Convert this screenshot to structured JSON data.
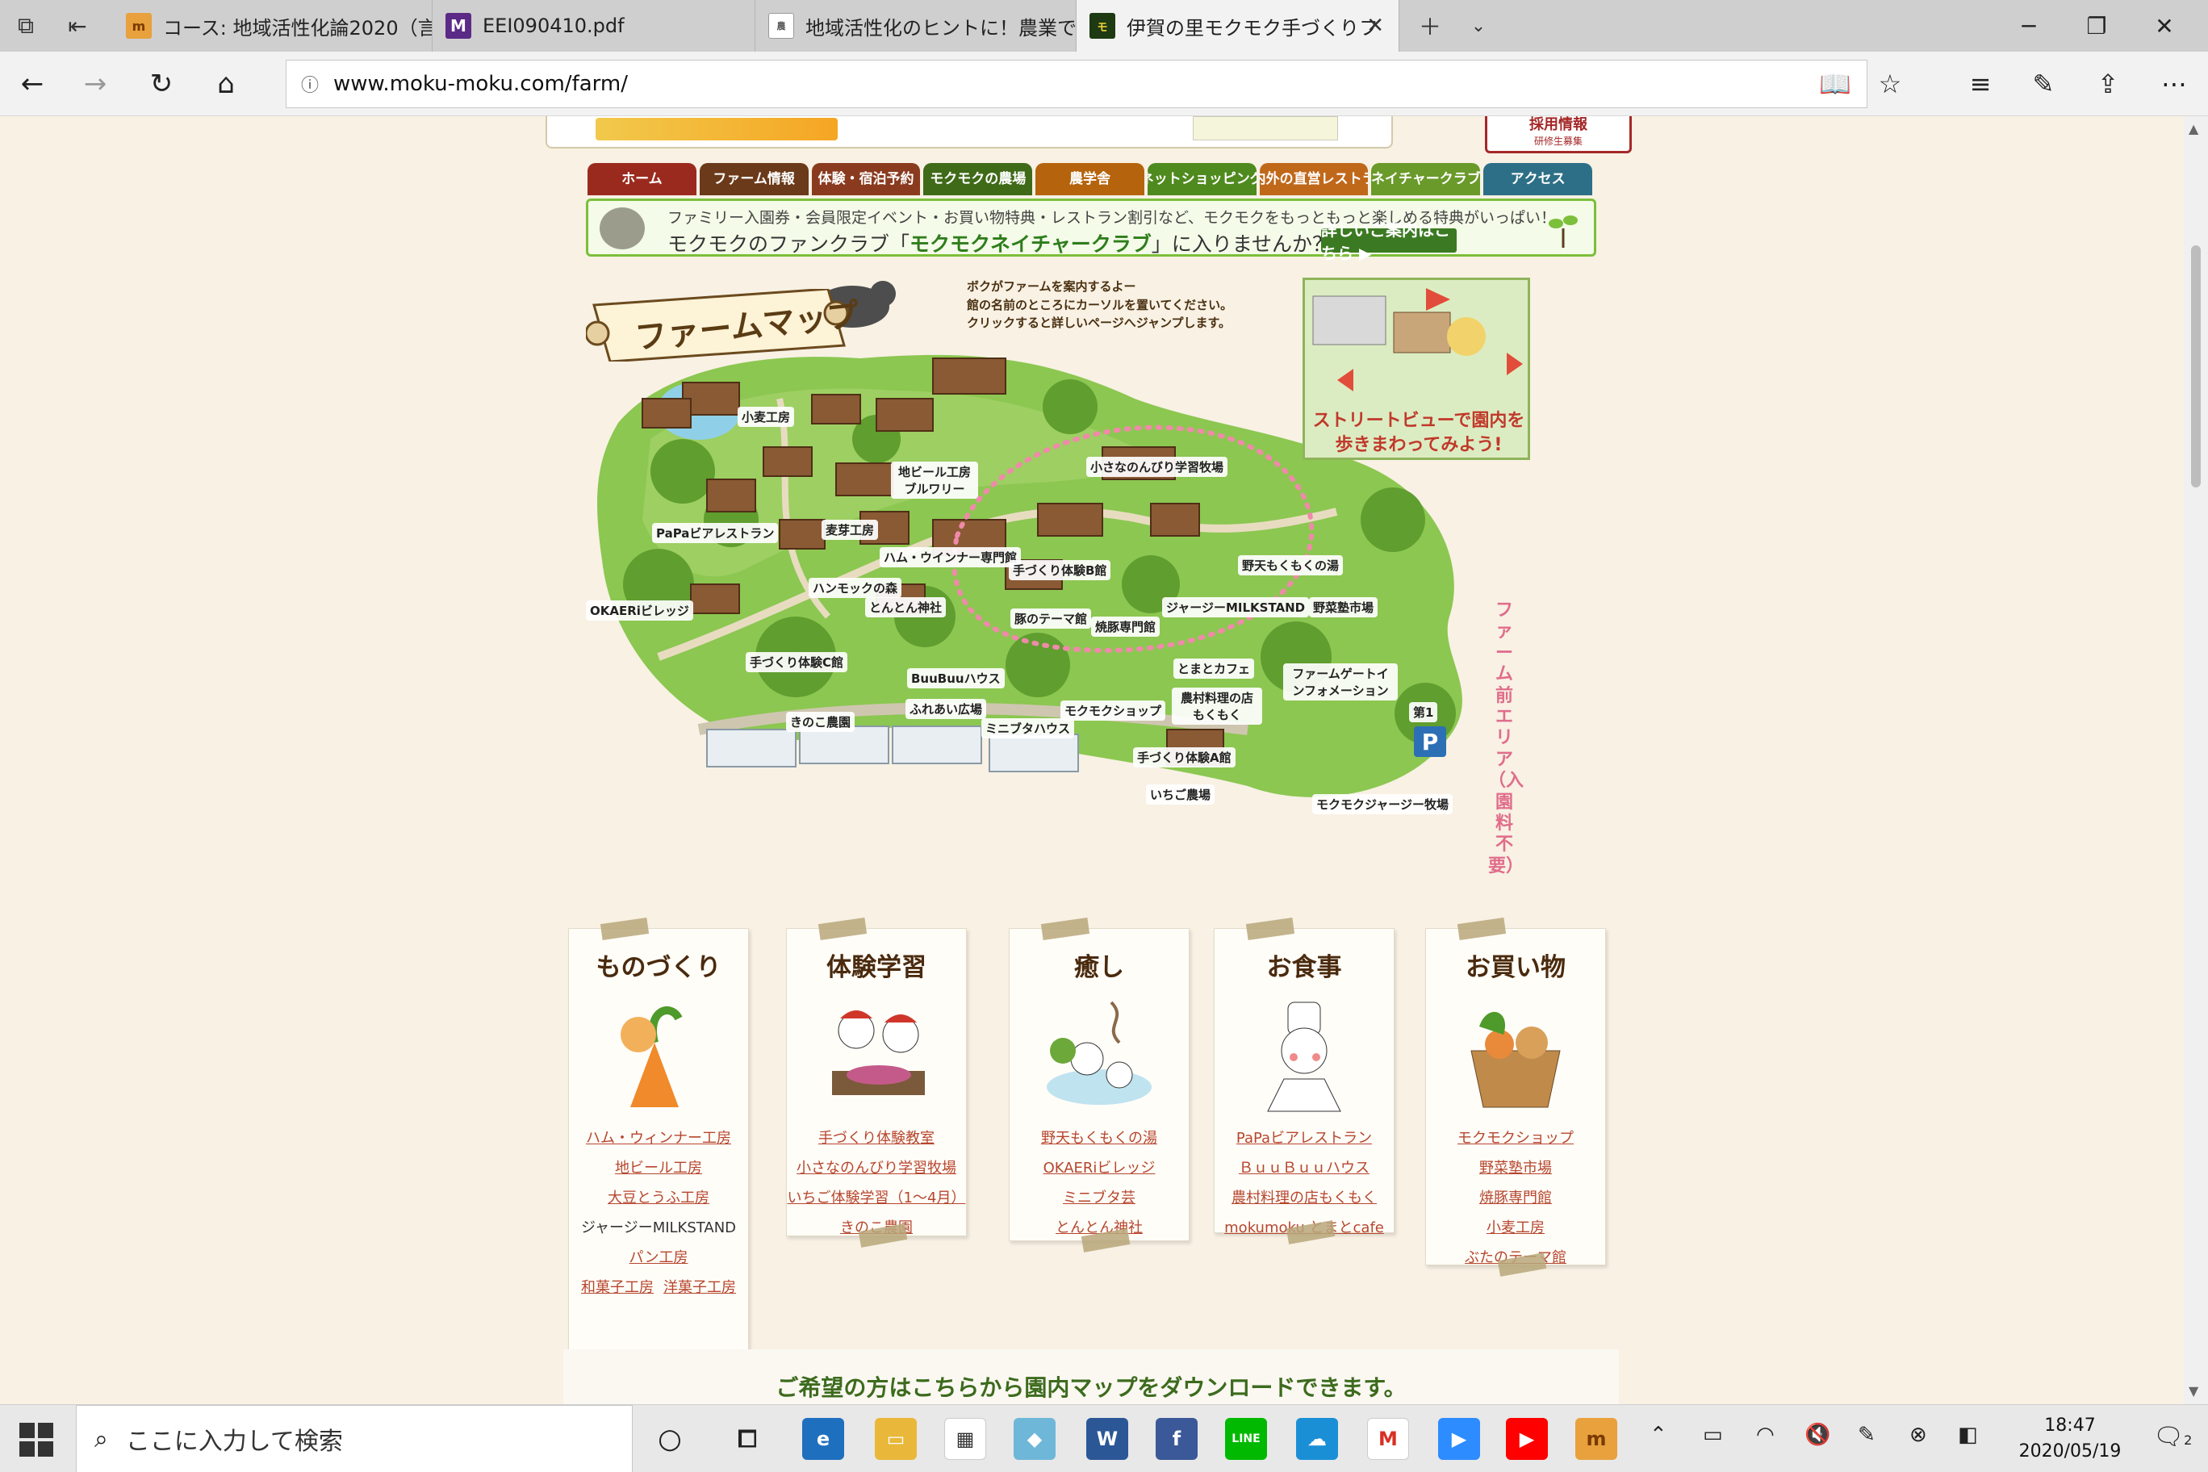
{
  "browser": {
    "tabs": [
      {
        "title": "コース: 地域活性化論2020（言",
        "favicon": "course-favicon",
        "active": false
      },
      {
        "title": "EEI090410.pdf",
        "favicon": "M",
        "active": false
      },
      {
        "title": "地域活性化のヒントに！農業で",
        "favicon": "news-favicon",
        "active": false
      },
      {
        "title": "伊賀の里モクモク手づくりフ",
        "favicon": "mokumoku-favicon",
        "active": true
      }
    ],
    "url": "www.moku-moku.com/farm/"
  },
  "header": {
    "recruit_title": "採用情報",
    "recruit_sub": "研修生募集",
    "nav": [
      {
        "label": "ホーム",
        "color": "#9b2a1e"
      },
      {
        "label": "ファーム情報",
        "color": "#6b3a1a"
      },
      {
        "label": "体験・宿泊予約",
        "color": "#8a3b1f"
      },
      {
        "label": "モクモクの農場",
        "color": "#3f6a18"
      },
      {
        "label": "農学舎",
        "color": "#b5640d"
      },
      {
        "label": "ネットショッピング",
        "color": "#4f8a1e"
      },
      {
        "label": "県内外の直営レストラン",
        "color": "#c0681a"
      },
      {
        "label": "ネイチャークラブ",
        "color": "#6a9a2a"
      },
      {
        "label": "アクセス",
        "color": "#2d6f86"
      }
    ]
  },
  "fanclub": {
    "line1": "ファミリー入園券・会員限定イベント・お買い物特典・レストラン割引など、モクモクをもっともっと楽しめる特典がいっぱい！",
    "line2_pre": "モクモクのファンクラブ「",
    "line2_name": "モクモクネイチャークラブ",
    "line2_post": "」に入りませんか？",
    "button": "詳しいご案内はこちら ▶"
  },
  "map": {
    "title": "ファームマップ",
    "intro": "ボクがファームを案内するよー\n館の名前のところにカーソルを置いてください。\nクリックすると詳しいページへジャンプします。",
    "streetview": "ストリートビューで園内を歩きまわってみよう!",
    "zone": "ファーム前エリア（入園料不要）",
    "parking_p": "P",
    "parking_no": "第1",
    "labels": [
      "小麦工房",
      "地ビール工房ブルワリー",
      "小さなのんびり学習牧場",
      "PaPaビアレストラン",
      "麦芽工房",
      "ハム・ウインナー専門館",
      "手づくり体験B館",
      "ハンモックの森",
      "OKAERiビレッジ",
      "とんとん神社",
      "豚のテーマ館",
      "焼豚専門館",
      "ジャージーMILKSTAND",
      "野天もくもくの湯",
      "野菜塾市場",
      "手づくり体験C館",
      "BuuBuuハウス",
      "とまとカフェ",
      "ファームゲートインフォメーション",
      "ふれあい広場",
      "モクモクショップ",
      "農村料理の店もくもく",
      "きのこ農園",
      "ミニブタハウス",
      "手づくり体験A館",
      "いちご農場",
      "モクモクジャージー牧場"
    ]
  },
  "categories": [
    {
      "title": "ものづくり",
      "icon": "carrot-illustration-icon",
      "links": [
        "ハム・ウィンナー工房",
        "地ビール工房",
        "大豆とうふ工房",
        "ジャージーMILKSTAND",
        "パン工房",
        "和菓子工房",
        "洋菓子工房"
      ]
    },
    {
      "title": "体験学習",
      "icon": "cooking-class-illustration-icon",
      "links": [
        "手づくり体験教室",
        "小さなのんびり学習牧場",
        "いちご体験学習（1〜4月）",
        "きのこ農園"
      ]
    },
    {
      "title": "癒し",
      "icon": "hot-spring-illustration-icon",
      "links": [
        "野天もくもくの湯",
        "OKAERiビレッジ",
        "ミニブタ芸",
        "とんとん神社"
      ]
    },
    {
      "title": "お食事",
      "icon": "chef-illustration-icon",
      "links": [
        "PaPaビアレストラン",
        "ＢｕｕＢｕｕハウス",
        "農村料理の店もくもく",
        "mokumoku とまとcafe"
      ]
    },
    {
      "title": "お買い物",
      "icon": "shopping-basket-illustration-icon",
      "links": [
        "モクモクショップ",
        "野菜塾市場",
        "焼豚専門館",
        "小麦工房",
        "ぶたのテーマ館"
      ]
    }
  ],
  "download_text": "ご希望の方はこちらから園内マップをダウンロードできます。",
  "taskbar": {
    "search_placeholder": "ここに入力して検索",
    "time": "18:47",
    "date": "2020/05/19",
    "notification_count": "2"
  }
}
